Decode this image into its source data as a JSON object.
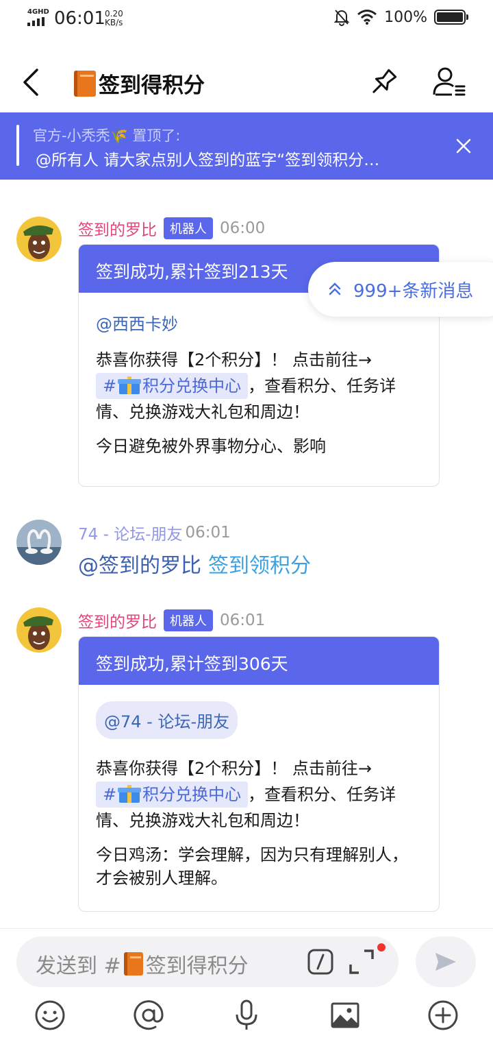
{
  "status_bar": {
    "network": "4GHD",
    "time": "06:01",
    "speed_value": "0.20",
    "speed_unit": "KB/s",
    "battery": "100%"
  },
  "header": {
    "title": "签到得积分"
  },
  "pinned": {
    "author_line": "官方-小秃秃🌾 置顶了:",
    "text": "@所有人 请大家点别人签到的蓝字“签到领积分…"
  },
  "new_messages": {
    "label": "999+条新消息"
  },
  "messages": [
    {
      "sender": "签到的罗比",
      "badge": "机器人",
      "time": "06:00",
      "card_title": "签到成功,累计签到213天",
      "mention": "@西西卡妙",
      "body_prefix": "恭喜你获得【2个积分】！ 点击前往→",
      "channel_hash": "#",
      "channel_name": "积分兑换中心",
      "body_suffix": "，查看积分、任务详情、兑换游戏大礼包和周边！",
      "extra": "今日避免被外界事物分心、影响"
    },
    {
      "sender": "74 - 论坛-朋友",
      "time": "06:01",
      "mention": "@签到的罗比",
      "command": "签到领积分"
    },
    {
      "sender": "签到的罗比",
      "badge": "机器人",
      "time": "06:01",
      "card_title": "签到成功,累计签到306天",
      "mention": "@74 - 论坛-朋友",
      "body_prefix": "恭喜你获得【2个积分】！ 点击前往→",
      "channel_hash": "#",
      "channel_name": "积分兑换中心",
      "body_suffix": "，查看积分、任务详情、兑换游戏大礼包和周边！",
      "extra": "今日鸡汤：学会理解，因为只有理解别人，才会被别人理解。"
    }
  ],
  "composer": {
    "placeholder_prefix": "发送到 #",
    "placeholder_channel": "签到得积分"
  },
  "icons": {
    "toolbar": [
      "emoji-icon",
      "at-icon",
      "mic-icon",
      "image-icon",
      "plus-icon"
    ]
  },
  "colors": {
    "accent": "#5a67ea",
    "bot_name": "#e0457b",
    "link": "#4a68d8"
  }
}
